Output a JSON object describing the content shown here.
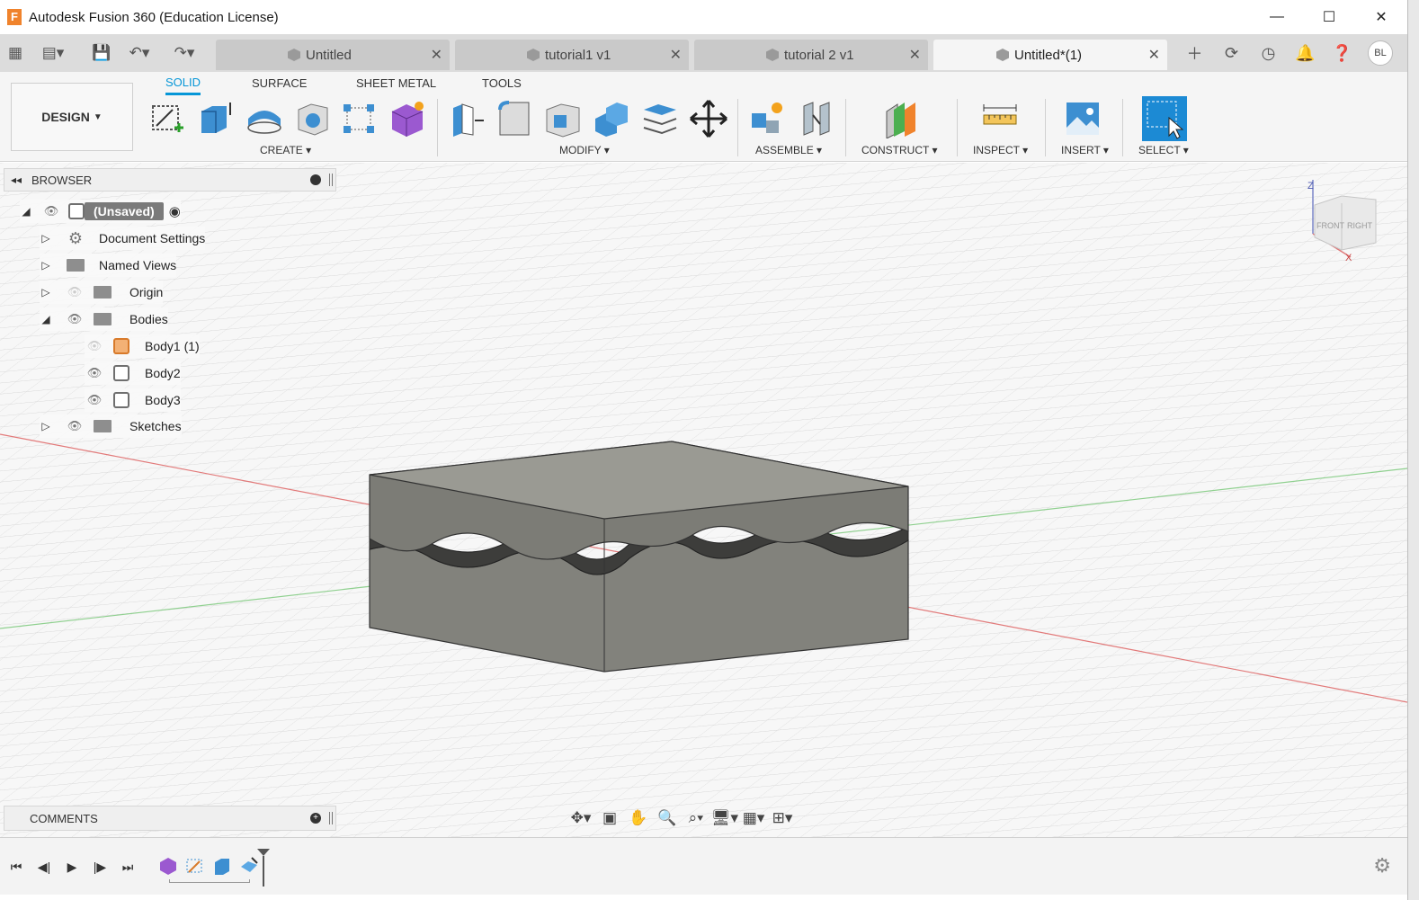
{
  "window": {
    "title": "Autodesk Fusion 360 (Education License)",
    "logo_letter": "F",
    "minimize_icon": "minimize-icon",
    "maximize_icon": "maximize-icon",
    "close_icon": "close-icon"
  },
  "tabs": [
    {
      "label": "Untitled",
      "close": "✕"
    },
    {
      "label": "tutorial1 v1",
      "close": "✕"
    },
    {
      "label": "tutorial 2 v1",
      "close": "✕"
    },
    {
      "label": "Untitled*(1)",
      "close": "✕"
    }
  ],
  "user": {
    "initials": "BL"
  },
  "ribbon": {
    "workspace": "DESIGN",
    "tabs": [
      "SOLID",
      "SURFACE",
      "SHEET METAL",
      "TOOLS"
    ],
    "groups": [
      "CREATE",
      "MODIFY",
      "ASSEMBLE",
      "CONSTRUCT",
      "INSPECT",
      "INSERT",
      "SELECT"
    ]
  },
  "browser": {
    "title": "BROWSER",
    "root": "(Unsaved)",
    "items": [
      "Document Settings",
      "Named Views",
      "Origin",
      "Bodies",
      "Body1 (1)",
      "Body2",
      "Body3",
      "Sketches"
    ]
  },
  "comments": {
    "title": "COMMENTS"
  },
  "viewcube": {
    "front": "FRONT",
    "right": "RIGHT",
    "axis_z": "Z",
    "axis_x": "X"
  },
  "colors": {
    "accent": "#0696d7",
    "body": "#8a8a84",
    "orange": "#f0832c"
  }
}
